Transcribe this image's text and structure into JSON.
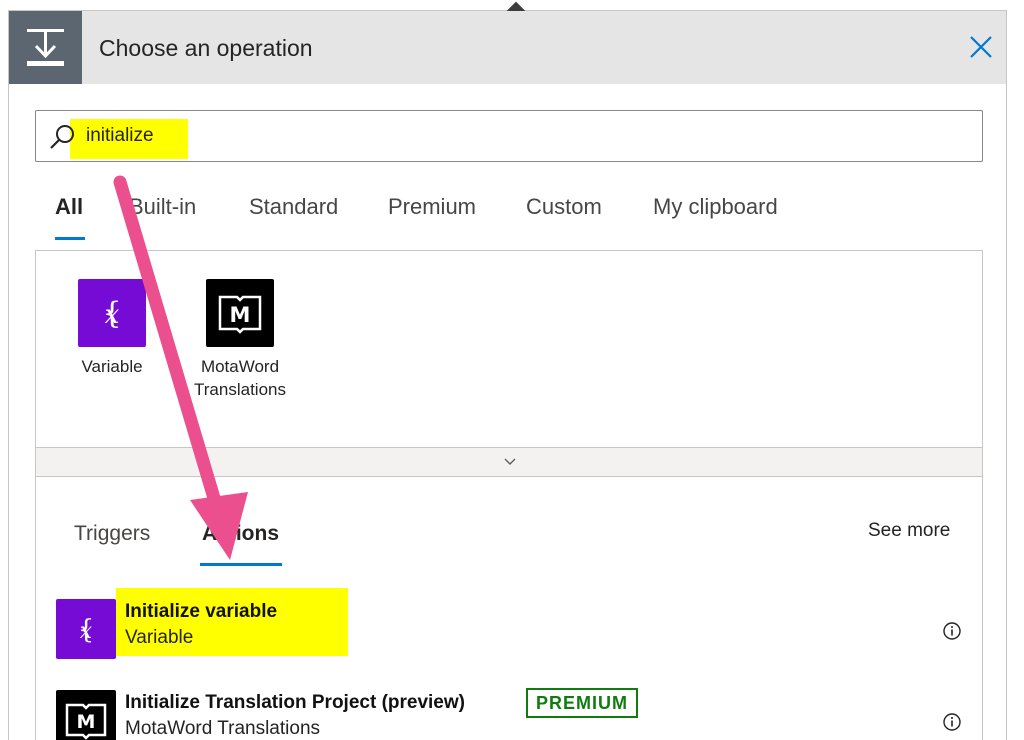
{
  "header": {
    "title": "Choose an operation"
  },
  "search": {
    "value": "initialize"
  },
  "tabs": [
    {
      "label": "All"
    },
    {
      "label": "Built-in"
    },
    {
      "label": "Standard"
    },
    {
      "label": "Premium"
    },
    {
      "label": "Custom"
    },
    {
      "label": "My clipboard"
    }
  ],
  "connectors": [
    {
      "label": "Variable",
      "icon": "variable-icon",
      "color": "#770bd6"
    },
    {
      "label": "MotaWord Translations",
      "icon": "motaword-icon",
      "color": "#000000"
    }
  ],
  "subtabs": [
    {
      "label": "Triggers"
    },
    {
      "label": "Actions"
    }
  ],
  "see_more": "See more",
  "actions": [
    {
      "title": "Initialize variable",
      "subtitle": "Variable",
      "icon": "variable-icon"
    },
    {
      "title": "Initialize Translation Project (preview)",
      "subtitle": "MotaWord Translations",
      "badge": "PREMIUM",
      "icon": "motaword-icon"
    }
  ],
  "colors": {
    "accent": "#0078d4",
    "highlight": "#ffff00",
    "arrow": "#ec4f8d",
    "premium": "#107c10"
  }
}
